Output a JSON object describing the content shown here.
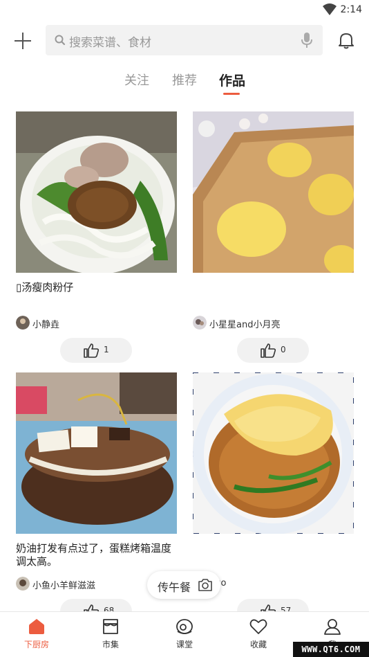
{
  "status_bar": {
    "time": "2:14"
  },
  "header": {
    "search_placeholder": "搜索菜谱、食材"
  },
  "tabs": [
    {
      "label": "关注",
      "active": false
    },
    {
      "label": "推荐",
      "active": false
    },
    {
      "label": "作品",
      "active": true
    }
  ],
  "feed": [
    {
      "title": "▯汤瘦肉粉仔",
      "author": "小静垚",
      "likes": "1",
      "photo": "rice noodle soup with minced pork and greens"
    },
    {
      "title": "",
      "author": "小星星and小月亮",
      "likes": "0",
      "photo": "hedgehog shaped steamed buns on wooden tray"
    },
    {
      "title": "奶油打发有点过了，蛋糕烤箱温度调太高。",
      "author": "小鱼小羊鲜滋滋",
      "likes": "68",
      "photo": "chocolate cake with cream and happy birthday topper"
    },
    {
      "title": "",
      "author": "nuo",
      "likes": "57",
      "photo": "fried noodles topped with omelette"
    }
  ],
  "float_button": {
    "label": "传午餐",
    "icon": "camera-icon"
  },
  "bottom_nav": [
    {
      "label": "下厨房",
      "icon": "house-icon",
      "active": true
    },
    {
      "label": "市集",
      "icon": "market-icon",
      "active": false
    },
    {
      "label": "课堂",
      "icon": "classroom-icon",
      "active": false
    },
    {
      "label": "收藏",
      "icon": "heart-icon",
      "active": false
    },
    {
      "label": "我",
      "icon": "profile-icon",
      "active": false
    }
  ],
  "watermark": "WWW.QT6.COM",
  "colors": {
    "accent": "#ec5c3f",
    "like_bg": "#f1f1f1",
    "search_bg": "#f2f2f2"
  }
}
